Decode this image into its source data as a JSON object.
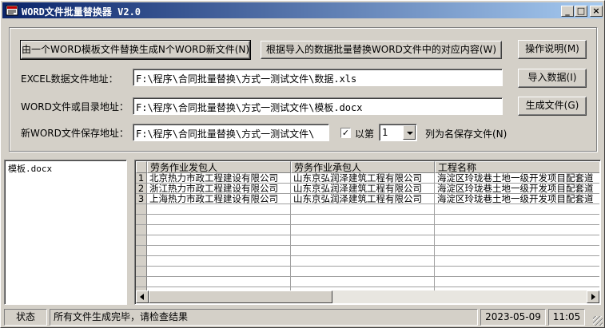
{
  "window": {
    "title": "WORD文件批量替换器 V2.0",
    "controls": {
      "minimize": "_",
      "maximize": "□",
      "close": "×"
    }
  },
  "buttons": {
    "generate_new": "由一个WORD模板文件替换生成N个WORD新文件(N)",
    "batch_replace": "根据导入的数据批量替换WORD文件中的对应内容(W)",
    "help": "操作说明(M)",
    "import_data": "导入数据(I)",
    "generate_file": "生成文件(G)"
  },
  "form": {
    "excel_label": "EXCEL数据文件地址：",
    "excel_value": "F:\\程序\\合同批量替换\\方式一测试文件\\数据.xls",
    "word_label": "WORD文件或目录地址：",
    "word_value": "F:\\程序\\合同批量替换\\方式一测试文件\\模板.docx",
    "save_label": "新WORD文件保存地址：",
    "save_value": "F:\\程序\\合同批量替换\\方式一测试文件\\",
    "checkbox_label": "以第",
    "checkbox_checked": true,
    "column_value": "1",
    "column_suffix": "列为名保存文件(N)"
  },
  "file_list": {
    "items": [
      "模板.docx"
    ]
  },
  "grid": {
    "headers": [
      "劳务作业发包人",
      "劳务作业承包人",
      "工程名称"
    ],
    "rows": [
      {
        "num": "1",
        "cells": [
          "北京热力市政工程建设有限公司",
          "山东京弘润泽建筑工程有限公司",
          "海淀区玲珑巷土地一级开发项目配套道"
        ]
      },
      {
        "num": "2",
        "cells": [
          "浙江热力市政工程建设有限公司",
          "山东京弘润泽建筑工程有限公司",
          "海淀区玲珑巷土地一级开发项目配套道"
        ]
      },
      {
        "num": "3",
        "cells": [
          "上海热力市政工程建设有限公司",
          "山东京弘润泽建筑工程有限公司",
          "海淀区玲珑巷土地一级开发项目配套道"
        ]
      }
    ]
  },
  "status": {
    "label": "状态",
    "message": "所有文件生成完毕，请检查结果",
    "date": "2023-05-09",
    "time": "11:05"
  },
  "icons": {
    "app": "app-icon",
    "dropdown": "chevron-down-icon",
    "scroll_left": "arrow-left-icon",
    "scroll_right": "arrow-right-icon"
  },
  "colors": {
    "title_gradient_start": "#0a246a",
    "title_gradient_end": "#a6caf0",
    "face": "#d4d0c8"
  }
}
